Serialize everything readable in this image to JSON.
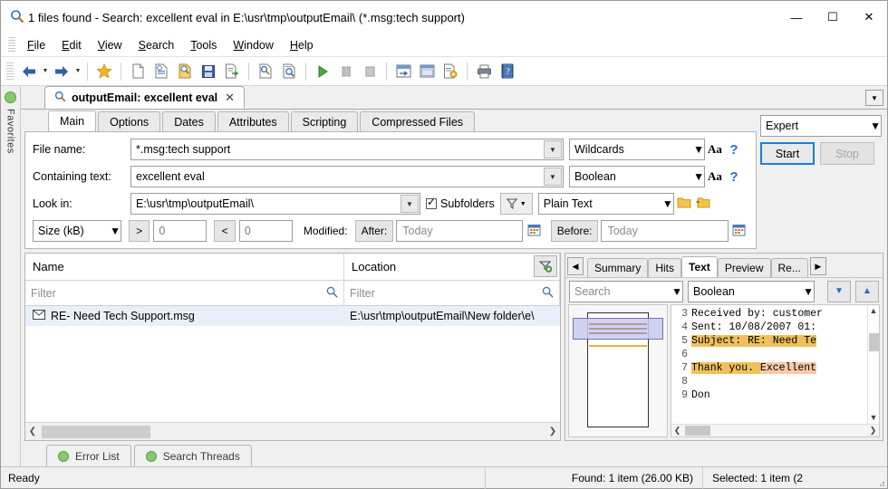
{
  "window": {
    "title": "1 files found - Search: excellent eval in E:\\usr\\tmp\\outputEmail\\ (*.msg:tech support)",
    "icon": "magnifier-icon",
    "minimize_label": "—",
    "maximize_label": "☐",
    "close_label": "✕"
  },
  "menubar": {
    "items": [
      {
        "label": "File",
        "accel": "F"
      },
      {
        "label": "Edit",
        "accel": "E"
      },
      {
        "label": "View",
        "accel": "V"
      },
      {
        "label": "Search",
        "accel": "S"
      },
      {
        "label": "Tools",
        "accel": "T"
      },
      {
        "label": "Window",
        "accel": "W"
      },
      {
        "label": "Help",
        "accel": "H"
      }
    ]
  },
  "toolbar": {
    "buttons": [
      {
        "name": "back-icon",
        "glyph": "⬅"
      },
      {
        "name": "back-dropdown-caret",
        "glyph": "▾"
      },
      {
        "name": "forward-icon",
        "glyph": "➡"
      },
      {
        "name": "forward-dropdown-caret",
        "glyph": "▾"
      },
      {
        "name": "favorites-star-icon",
        "glyph": "★"
      },
      {
        "name": "new-search-icon",
        "glyph": "⬜"
      },
      {
        "name": "open-search-icon",
        "glyph": "⬜"
      },
      {
        "name": "load-criteria-icon",
        "glyph": "⬜"
      },
      {
        "name": "save-icon",
        "glyph": "⬜"
      },
      {
        "name": "export-icon",
        "glyph": "⬜"
      },
      {
        "name": "preview-icon",
        "glyph": "⬜"
      },
      {
        "name": "find-in-results-icon",
        "glyph": "⬜"
      },
      {
        "name": "start-search-icon",
        "glyph": "▶"
      },
      {
        "name": "pause-search-icon",
        "glyph": "▐▌"
      },
      {
        "name": "stop-search-icon",
        "glyph": "■"
      },
      {
        "name": "layout-icon",
        "glyph": "⬜"
      },
      {
        "name": "window-layout-icon",
        "glyph": "⬜"
      },
      {
        "name": "options-icon",
        "glyph": "⬜"
      },
      {
        "name": "print-icon",
        "glyph": "⬜"
      },
      {
        "name": "help-book-icon",
        "glyph": "⬜"
      }
    ]
  },
  "favorites": {
    "label": "Favorites"
  },
  "doctab": {
    "title": "outputEmail: excellent eval",
    "close_label": "✕",
    "dropdown_glyph": "▼"
  },
  "criteria": {
    "tabs": [
      {
        "label": "Main",
        "active": true
      },
      {
        "label": "Options",
        "active": false
      },
      {
        "label": "Dates",
        "active": false
      },
      {
        "label": "Attributes",
        "active": false
      },
      {
        "label": "Scripting",
        "active": false
      },
      {
        "label": "Compressed Files",
        "active": false
      }
    ],
    "filename": {
      "label": "File name:",
      "value": "*.msg:tech support",
      "mode": "Wildcards",
      "case_button": "Aa",
      "help_button": "?"
    },
    "containing_text": {
      "label": "Containing text:",
      "value": "excellent eval",
      "mode": "Boolean",
      "case_button": "Aa",
      "help_button": "?"
    },
    "look_in": {
      "label": "Look in:",
      "value": "E:\\usr\\tmp\\outputEmail\\",
      "subfolders_label": "Subfolders",
      "subfolders_checked": true,
      "format": "Plain Text",
      "browse_icon": "folder-icon",
      "index_icon": "folder-link-icon",
      "filter_icon": "funnel-icon"
    },
    "size": {
      "unit": "Size (kB)",
      "gt_label": ">",
      "gt_value": "0",
      "lt_label": "<",
      "lt_value": "0"
    },
    "modified": {
      "label": "Modified:",
      "after_label": "After:",
      "after_value": "Today",
      "before_label": "Before:",
      "before_value": "Today",
      "calendar_icon": "calendar-icon"
    },
    "mode_select": "Expert",
    "start_button": "Start",
    "stop_button": "Stop"
  },
  "results": {
    "columns": [
      "Name",
      "Location"
    ],
    "filter_placeholder": "Filter",
    "rows": [
      {
        "icon": "envelope-icon",
        "name": "RE- Need Tech Support.msg",
        "location": "E:\\usr\\tmp\\outputEmail\\New folder\\e\\"
      }
    ]
  },
  "preview": {
    "tabs": [
      {
        "label": "Summary",
        "active": false
      },
      {
        "label": "Hits",
        "active": false
      },
      {
        "label": "Text",
        "active": true
      },
      {
        "label": "Preview",
        "active": false
      },
      {
        "label": "Re...",
        "active": false
      }
    ],
    "nav_prev": "◀",
    "nav_next": "▶",
    "search_placeholder": "Search",
    "search_mode": "Boolean",
    "prev_hit_glyph": "▼",
    "next_hit_glyph": "▲",
    "lines": [
      {
        "num": "3",
        "text": "Received by: customer",
        "highlight": "none"
      },
      {
        "num": "4",
        "text": "Sent: 10/08/2007 01:",
        "highlight": "none"
      },
      {
        "num": "5",
        "text": "Subject: RE: Need Te",
        "highlight": "full"
      },
      {
        "num": "6",
        "text": "",
        "highlight": "none"
      },
      {
        "num": "7",
        "text": "Thank you. Excellent",
        "highlight": "split",
        "plain": "Thank you. ",
        "accent": "Excellent"
      },
      {
        "num": "8",
        "text": "",
        "highlight": "none"
      },
      {
        "num": "9",
        "text": "Don",
        "highlight": "none"
      }
    ]
  },
  "bottom_tabs": [
    {
      "label": "Error List",
      "status": "ok"
    },
    {
      "label": "Search Threads",
      "status": "ok"
    }
  ],
  "status": {
    "ready": "Ready",
    "found": "Found: 1 item (26.00 KB)",
    "selected": "Selected: 1 item (2"
  },
  "colors": {
    "accent": "#1a7fd4",
    "highlight": "#f0c05c",
    "highlight_accent": "#fbc9a6",
    "row_selected": "#eaf0fb",
    "status_ok": "#86c96c"
  }
}
